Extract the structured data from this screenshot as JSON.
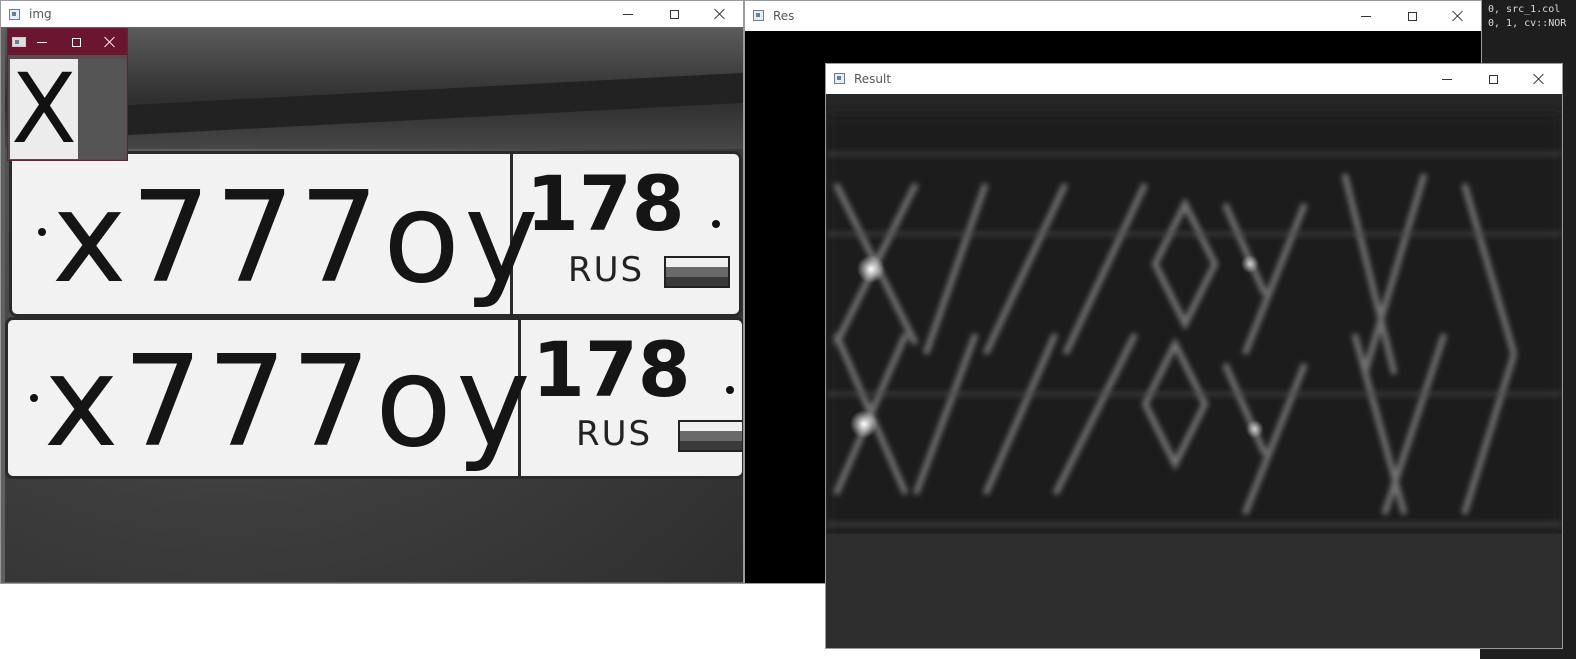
{
  "code_editor": {
    "lines": [
      "0, src_1.col",
      "0, 1, cv::NOR"
    ]
  },
  "windows": {
    "img": {
      "title": "img",
      "plates": [
        {
          "code": "x777oy",
          "region": "178",
          "country": "RUS"
        },
        {
          "code": "x777oy",
          "region": "178",
          "country": "RUS"
        }
      ]
    },
    "template": {
      "title": "",
      "glyph": "X"
    },
    "res": {
      "title": "Res"
    },
    "result": {
      "title": "Result"
    }
  },
  "colors": {
    "template_titlebar": "#6b1530",
    "flag_white": "#f0f0f0",
    "flag_blue": "#6a6a6a",
    "flag_red": "#3a3a3a"
  },
  "icons": [
    "app-window-icon",
    "minimize-icon",
    "maximize-icon",
    "close-icon"
  ]
}
